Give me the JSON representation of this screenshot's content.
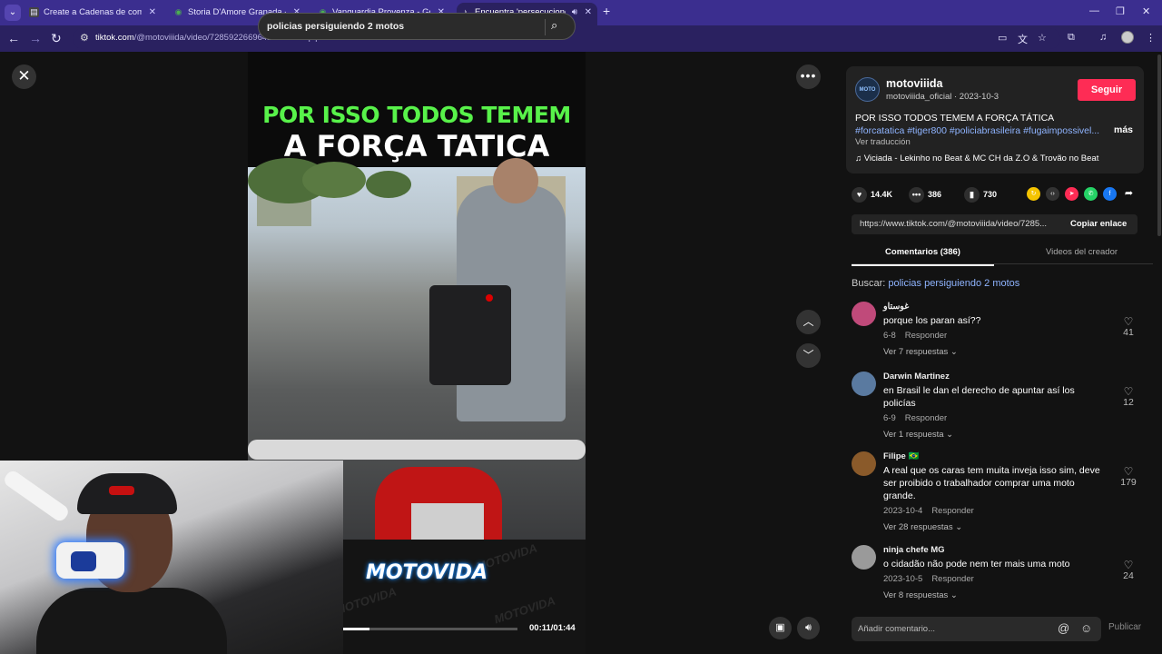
{
  "browser": {
    "tabs": [
      {
        "title": "Create a Cadenas de comidas r",
        "close": "✕"
      },
      {
        "title": "Storia D'Amore Granada - Goo",
        "close": "✕"
      },
      {
        "title": "Vanguardia Provenza - Google",
        "close": "✕"
      },
      {
        "title": "Encuentra 'persecuciones b",
        "close": "✕"
      }
    ],
    "url_host": "tiktok.com",
    "url_path": "/@motoviiida/video/7285922669642501382?q=persecuciones%20brasil&t=1756352916148"
  },
  "player": {
    "search_query": "policias persiguiendo 2 motos",
    "overlay_line1": "POR ISSO TODOS TEMEM",
    "overlay_line2": "A FORÇA TATICA",
    "watermark": "MOTOVIDA",
    "progress_fraction": 0.15,
    "time": "00:11/01:44"
  },
  "post": {
    "username": "motoviiida",
    "handle_date": "motoviiida_oficial · 2023-10-3",
    "follow_label": "Seguir",
    "desc_text": "POR ISSO TODOS TEMEM A FORÇA TÁTICA ",
    "hashtags": [
      "#forcatatica",
      "#tiger800",
      "#policiabrasileira",
      "#fugaimpossivel..."
    ],
    "more_label": "más",
    "translate_label": "Ver traducción",
    "music": "♫  Viciada - Lekinho no Beat & MC CH da Z.O & Trovão no Beat",
    "likes": "14.4K",
    "comments": "386",
    "saves": "730",
    "link": "https://www.tiktok.com/@motoviiida/video/7285...",
    "copy_label": "Copiar enlace",
    "tab_comments": "Comentarios (386)",
    "tab_creator": "Videos del creador",
    "search_label": "Buscar: ",
    "search_term": "policias persiguiendo 2 motos"
  },
  "comments": [
    {
      "name": "غوستاو",
      "text": "porque los paran así??",
      "date": "6-8",
      "reply": "Responder",
      "replies": "Ver 7 respuestas ⌄",
      "likes": "41",
      "avatar_color": "#c04a7a"
    },
    {
      "name": "Darwin Martinez",
      "text": "en Brasil le dan el derecho de apuntar así los policías",
      "date": "6-9",
      "reply": "Responder",
      "replies": "Ver 1 respuesta ⌄",
      "likes": "12",
      "avatar_color": "#5a7aa0"
    },
    {
      "name": "Filipe 🇧🇷",
      "text": "A real que os caras tem muita inveja isso sim, deve ser proibido o trabalhador comprar uma moto grande.",
      "date": "2023-10-4",
      "reply": "Responder",
      "replies": "Ver 28 respuestas ⌄",
      "likes": "179",
      "avatar_color": "#8a5a2a"
    },
    {
      "name": "ninja chefe MG",
      "text": "o cidadão não pode nem ter mais uma moto",
      "date": "2023-10-5",
      "reply": "Responder",
      "replies": "Ver 8 respuestas ⌄",
      "likes": "24",
      "avatar_color": "#9a9a9a"
    }
  ],
  "composer": {
    "placeholder": "Añadir comentario...",
    "publish": "Publicar"
  },
  "colors": {
    "accent": "#fe2c55",
    "link": "#8fb4ff",
    "tabbar": "#3b2e8f"
  }
}
